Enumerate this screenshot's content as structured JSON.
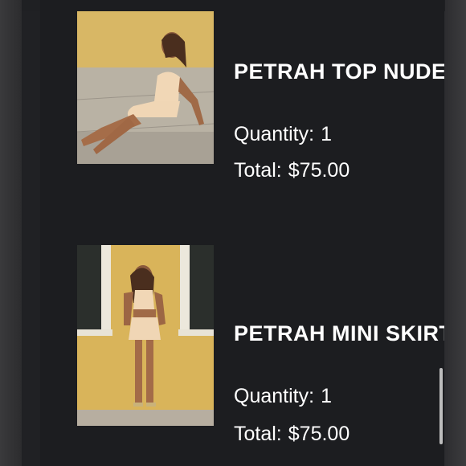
{
  "cart": {
    "items": [
      {
        "name": "PETRAH TOP NUDE",
        "quantity_label": "Quantity:",
        "quantity": "1",
        "total_label": "Total:",
        "total": "$75.00"
      },
      {
        "name": "PETRAH MINI SKIRT",
        "quantity_label": "Quantity:",
        "quantity": "1",
        "total_label": "Total:",
        "total": "$75.00"
      }
    ]
  },
  "colors": {
    "background": "#1c1d20",
    "text": "#ffffff",
    "wall_yellow": "#d9b45a"
  }
}
